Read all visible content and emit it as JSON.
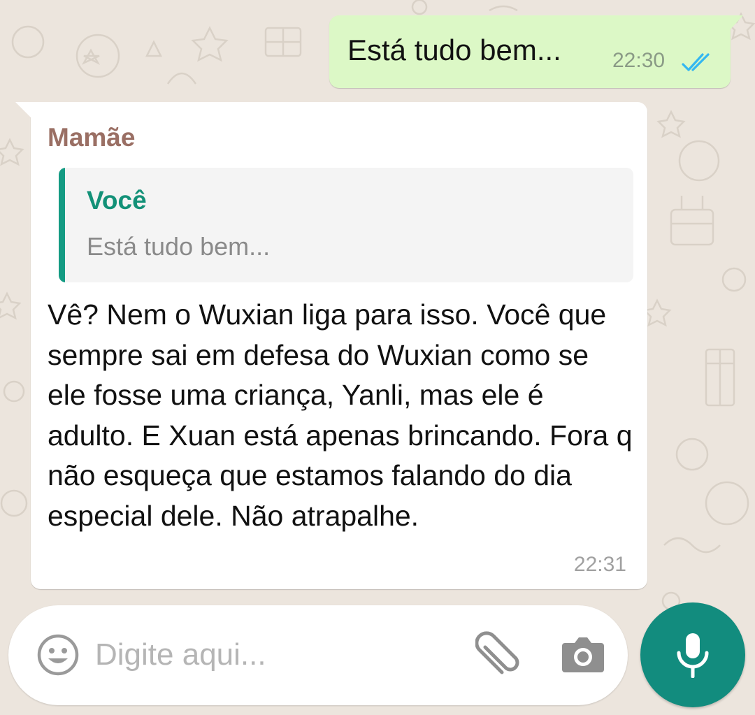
{
  "colors": {
    "outgoing_bubble": "#dcf8c6",
    "incoming_bubble": "#ffffff",
    "sender_name": "#9a6f64",
    "quote_author": "#139178",
    "accent": "#128c7e",
    "read_ticks": "#34b7f1"
  },
  "messages": {
    "outgoing": {
      "text": "Está tudo bem...",
      "time": "22:30",
      "status_icon": "double-check-read-icon"
    },
    "incoming": {
      "sender": "Mamãe",
      "quoted": {
        "author": "Você",
        "text": "Está tudo bem..."
      },
      "text": "Vê? Nem o Wuxian liga para isso. Você que sempre sai em defesa do Wuxian como se ele fosse uma criança, Yanli, mas ele é adulto. E Xuan está apenas brincando. Fora q não esqueça que estamos falando do dia especial dele. Não atrapalhe.",
      "time": "22:31"
    }
  },
  "composer": {
    "placeholder": "Digite aqui...",
    "emoji_icon": "emoji-icon",
    "attach_icon": "paperclip-icon",
    "camera_icon": "camera-icon",
    "send_icon": "microphone-icon"
  }
}
